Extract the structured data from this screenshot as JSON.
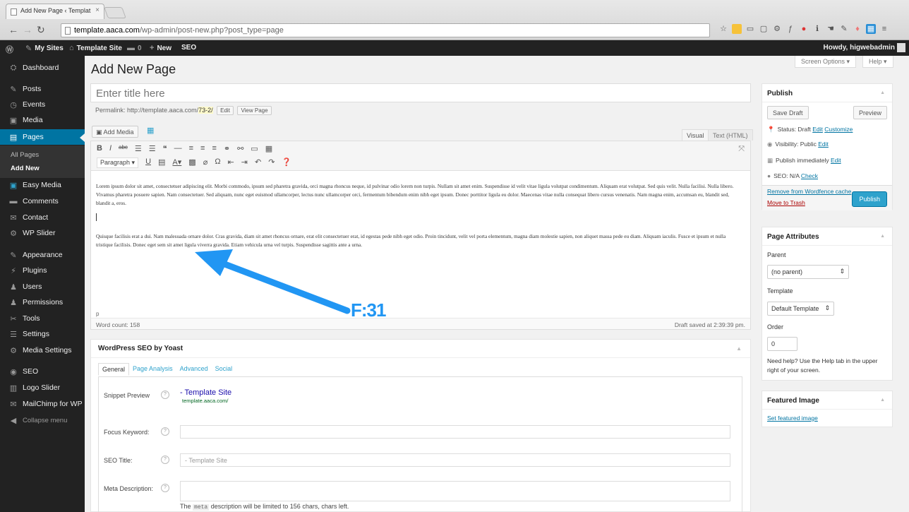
{
  "browser": {
    "tab_title": "Add New Page ‹ Templat",
    "tab_close": "×",
    "url_domain": "template.aaca.com",
    "url_path": "/wp-admin/post-new.php?post_type=page"
  },
  "adminbar": {
    "my_sites": "My Sites",
    "site_name": "Template Site",
    "comments_count": "0",
    "new": "New",
    "seo": "SEO",
    "howdy": "Howdy, higwebadmin"
  },
  "sidebar": {
    "items": [
      {
        "label": "Dashboard",
        "icon": "⛭"
      },
      {
        "label": "Posts",
        "icon": "✎"
      },
      {
        "label": "Events",
        "icon": "◷"
      },
      {
        "label": "Media",
        "icon": "▣"
      },
      {
        "label": "Pages",
        "icon": "▤"
      },
      {
        "label": "Easy Media",
        "icon": "▣"
      },
      {
        "label": "Comments",
        "icon": "▬"
      },
      {
        "label": "Contact",
        "icon": "✉"
      },
      {
        "label": "WP Slider",
        "icon": "⚙"
      },
      {
        "label": "Appearance",
        "icon": "✎"
      },
      {
        "label": "Plugins",
        "icon": "⚡"
      },
      {
        "label": "Users",
        "icon": "♟"
      },
      {
        "label": "Permissions",
        "icon": "♟"
      },
      {
        "label": "Tools",
        "icon": "✂"
      },
      {
        "label": "Settings",
        "icon": "☰"
      },
      {
        "label": "Media Settings",
        "icon": "⚙"
      },
      {
        "label": "SEO",
        "icon": "◉"
      },
      {
        "label": "Logo Slider",
        "icon": "▥"
      },
      {
        "label": "MailChimp for WP",
        "icon": "✉"
      },
      {
        "label": "Collapse menu",
        "icon": "◀"
      }
    ],
    "submenu": {
      "all_pages": "All Pages",
      "add_new": "Add New"
    }
  },
  "main": {
    "page_title": "Add New Page",
    "screen_options": "Screen Options ▾",
    "help": "Help ▾",
    "title_placeholder": "Enter title here",
    "permalink_label": "Permalink:",
    "permalink_base": "http://template.aaca.com/",
    "permalink_slug": "73-2/",
    "edit_btn": "Edit",
    "view_page_btn": "View Page",
    "add_media": "Add Media",
    "tab_visual": "Visual",
    "tab_text": "Text (HTML)",
    "format_select": "Paragraph",
    "paragraph1": "Lorem ipsum dolor sit amet, consectetuer adipiscing elit. Morbi commodo, ipsum sed pharetra gravida, orci magna rhoncus neque, id pulvinar odio lorem non turpis. Nullam sit amet enim. Suspendisse id velit vitae ligula volutpat condimentum. Aliquam erat volutpat. Sed quis velit. Nulla facilisi. Nulla libero. Vivamus pharetra posuere sapien. Nam consectetuer. Sed aliquam, nunc eget euismod ullamcorper, lectus nunc ullamcorper orci, fermentum bibendum enim nibh eget ipsum. Donec porttitor ligula eu dolor. Maecenas vitae nulla consequat libero cursus venenatis. Nam magna enim, accumsan eu, blandit sed, blandit a, eros.",
    "paragraph2": "Quisque facilisis erat a dui. Nam malesuada ornare dolor. Cras gravida, diam sit amet rhoncus ornare, erat elit consectetuer erat, id egestas pede nibh eget odio. Proin tincidunt, velit vel porta elementum, magna diam molestie sapien, non aliquet massa pede eu diam. Aliquam iaculis. Fusce et ipsum et nulla tristique facilisis. Donec eget sem sit amet ligula viverra gravida. Etiam vehicula urna vel turpis. Suspendisse sagittis ante a urna.",
    "path": "p",
    "word_count": "Word count: 158",
    "draft_saved": "Draft saved at 2:39:39 pm.",
    "annotation": "F:31"
  },
  "seo_box": {
    "title": "WordPress SEO by Yoast",
    "tabs": [
      "General",
      "Page Analysis",
      "Advanced",
      "Social"
    ],
    "snippet_label": "Snippet Preview",
    "snippet_title": "- Template Site",
    "snippet_url": "template.aaca.com/",
    "focus_label": "Focus Keyword:",
    "seo_title_label": "SEO Title:",
    "seo_title_placeholder": "- Template Site",
    "meta_desc_label": "Meta Description:",
    "meta_note_pre": "The",
    "meta_note_code": "meta",
    "meta_note_post": "description will be limited to 156 chars, chars left."
  },
  "publish": {
    "title": "Publish",
    "save_draft": "Save Draft",
    "preview": "Preview",
    "status_label": "Status: Draft",
    "status_edit": "Edit",
    "status_customize": "Customize",
    "visibility_label": "Visibility: Public",
    "visibility_edit": "Edit",
    "publish_time": "Publish immediately",
    "publish_time_edit": "Edit",
    "seo_label": "SEO: N/A",
    "seo_check": "Check",
    "wordfence": "Remove from Wordfence cache",
    "trash": "Move to Trash",
    "publish_btn": "Publish"
  },
  "page_attributes": {
    "title": "Page Attributes",
    "parent_label": "Parent",
    "parent_value": "(no parent)",
    "template_label": "Template",
    "template_value": "Default Template",
    "order_label": "Order",
    "order_value": "0",
    "help_text": "Need help? Use the Help tab in the upper right of your screen."
  },
  "featured_image": {
    "title": "Featured Image",
    "link": "Set featured image"
  },
  "colors": {
    "accent": "#0074a2",
    "primary_button": "#2ea2cc",
    "annotation": "#2196f3"
  }
}
